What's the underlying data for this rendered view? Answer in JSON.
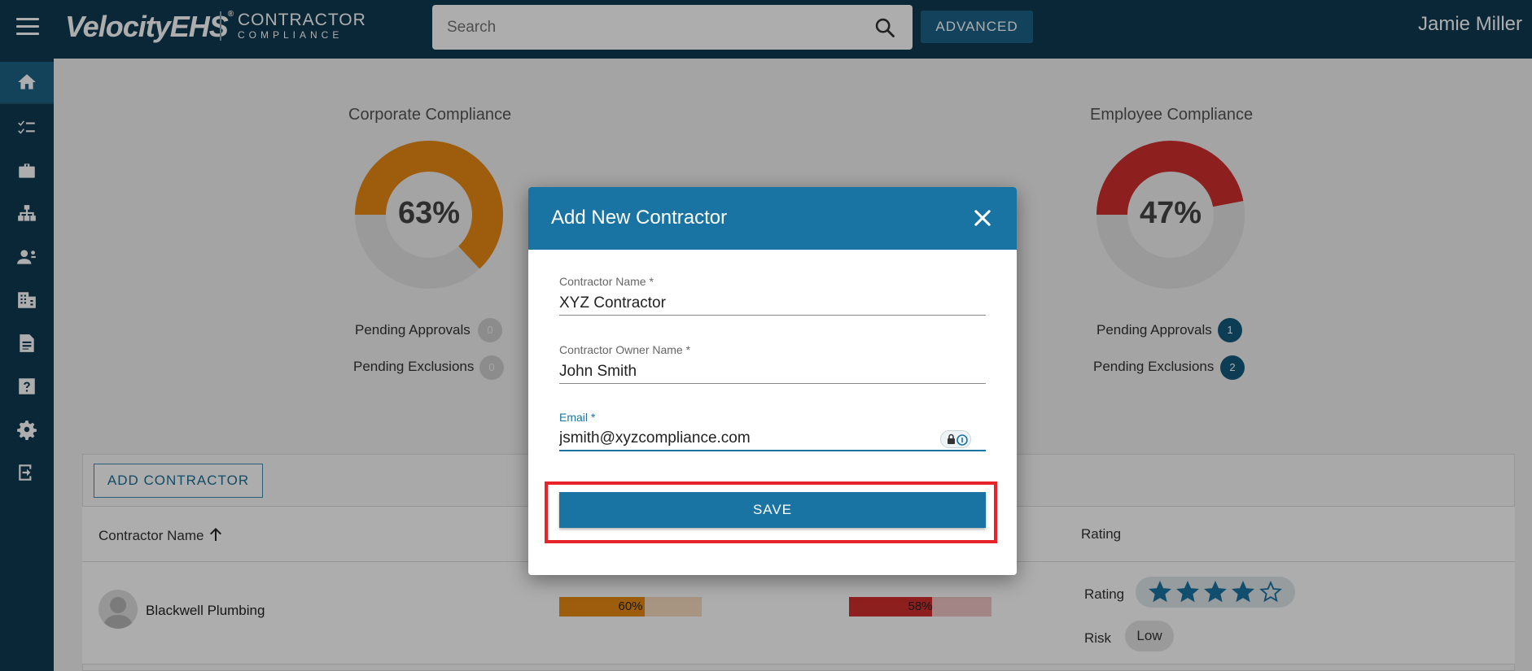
{
  "header": {
    "brand": "VelocityEHS",
    "brand_mark": "®",
    "product_line1": "CONTRACTOR",
    "product_line2": "COMPLIANCE",
    "search_placeholder": "Search",
    "advanced_label": "ADVANCED",
    "user_name": "Jamie Miller"
  },
  "sidebar": {
    "items": [
      {
        "icon": "home-icon",
        "active": true
      },
      {
        "icon": "checklist-icon"
      },
      {
        "icon": "briefcase-icon"
      },
      {
        "icon": "org-chart-icon"
      },
      {
        "icon": "worker-icon"
      },
      {
        "icon": "building-icon"
      },
      {
        "icon": "document-icon"
      },
      {
        "icon": "help-icon"
      },
      {
        "icon": "settings-icon"
      },
      {
        "icon": "logout-icon"
      }
    ]
  },
  "dashboard": {
    "corporate": {
      "title": "Corporate Compliance",
      "percent_label": "63%",
      "percent": 63,
      "color": "#e88a12",
      "pending_approvals_label": "Pending Approvals",
      "pending_approvals": "0",
      "pending_exclusions_label": "Pending Exclusions",
      "pending_exclusions": "0"
    },
    "employee": {
      "title": "Employee Compliance",
      "percent_label": "47%",
      "percent": 47,
      "color": "#d22e2e",
      "pending_approvals_label": "Pending Approvals",
      "pending_approvals": "1",
      "pending_exclusions_label": "Pending Exclusions",
      "pending_exclusions": "2"
    }
  },
  "table": {
    "add_button": "ADD CONTRACTOR",
    "columns": [
      "Contractor Name",
      "Rating"
    ],
    "rows": [
      {
        "name": "Blackwell Plumbing",
        "corporate_bar": "60%",
        "corporate_value": 60,
        "employee_bar": "58%",
        "employee_value": 58,
        "rating_label": "Rating",
        "rating": 4,
        "rating_max": 5,
        "risk_label": "Risk",
        "risk": "Low"
      }
    ]
  },
  "modal": {
    "title": "Add New Contractor",
    "fields": [
      {
        "label": "Contractor Name *",
        "value": "XYZ Contractor"
      },
      {
        "label": "Contractor Owner Name *",
        "value": "John Smith"
      },
      {
        "label": "Email *",
        "value": "jsmith@xyzcompliance.com"
      }
    ],
    "save_label": "SAVE"
  }
}
